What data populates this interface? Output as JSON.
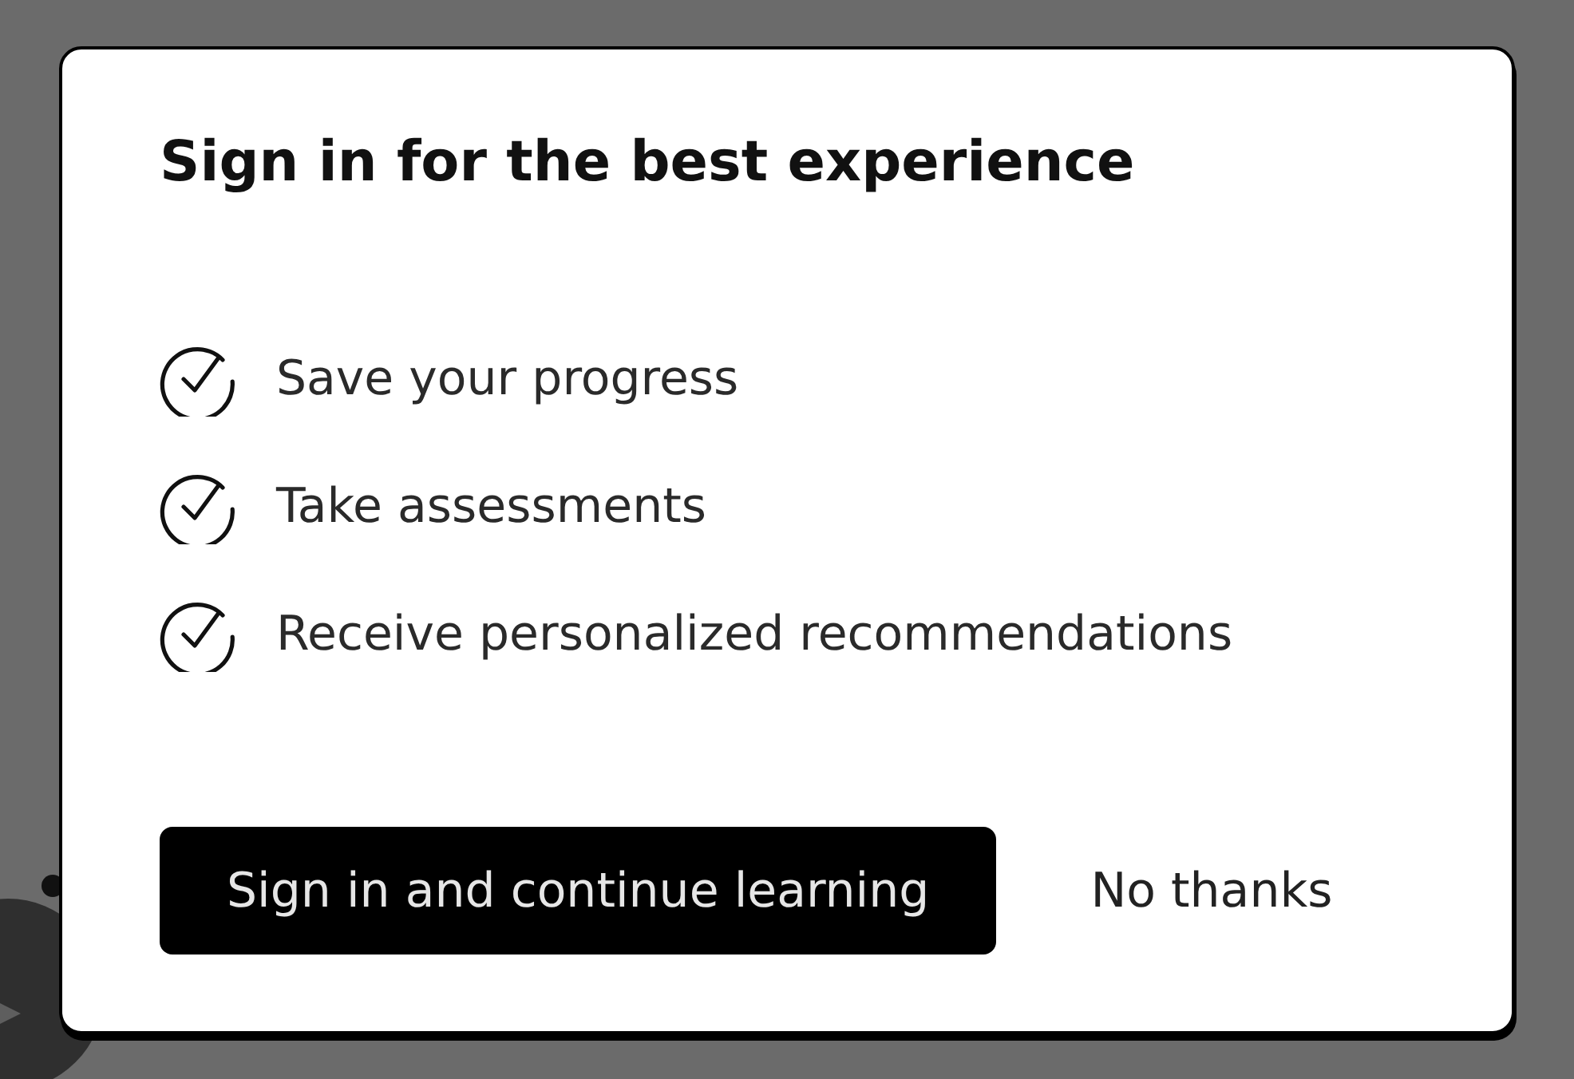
{
  "dialog": {
    "title": "Sign in for the best experience",
    "benefits": [
      {
        "label": "Save your progress"
      },
      {
        "label": "Take assessments"
      },
      {
        "label": "Receive personalized recommendations"
      }
    ],
    "buttons": [
      {
        "label": "Sign in and continue learning",
        "kind": "primary"
      },
      {
        "label": "No thanks",
        "kind": "text"
      }
    ]
  }
}
